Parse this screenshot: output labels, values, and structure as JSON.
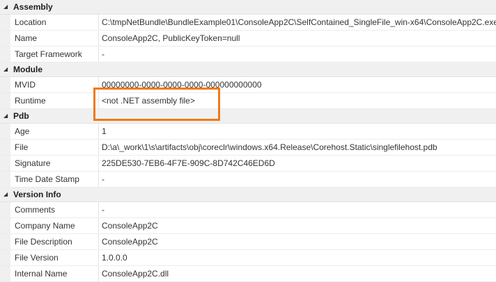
{
  "sections": [
    {
      "title": "Assembly",
      "expanded_glyph": "◢",
      "rows": [
        {
          "key": "Location",
          "value": "C:\\tmpNetBundle\\BundleExample01\\ConsoleApp2C\\SelfContained_SingleFile_win-x64\\ConsoleApp2C.exe"
        },
        {
          "key": "Name",
          "value": "ConsoleApp2C, PublicKeyToken=null"
        },
        {
          "key": "Target Framework",
          "value": "-"
        }
      ]
    },
    {
      "title": "Module",
      "expanded_glyph": "◢",
      "rows": [
        {
          "key": "MVID",
          "value": "00000000-0000-0000-0000-000000000000"
        },
        {
          "key": "Runtime",
          "value": "<not .NET assembly file>"
        }
      ]
    },
    {
      "title": "Pdb",
      "expanded_glyph": "◢",
      "rows": [
        {
          "key": "Age",
          "value": "1"
        },
        {
          "key": "File",
          "value": "D:\\a\\_work\\1\\s\\artifacts\\obj\\coreclr\\windows.x64.Release\\Corehost.Static\\singlefilehost.pdb"
        },
        {
          "key": "Signature",
          "value": "225DE530-7EB6-4F7E-909C-8D742C46ED6D"
        },
        {
          "key": "Time Date Stamp",
          "value": "-"
        }
      ]
    },
    {
      "title": "Version Info",
      "expanded_glyph": "◢",
      "rows": [
        {
          "key": "Comments",
          "value": "-"
        },
        {
          "key": "Company Name",
          "value": "ConsoleApp2C"
        },
        {
          "key": "File Description",
          "value": "ConsoleApp2C"
        },
        {
          "key": "File Version",
          "value": "1.0.0.0"
        },
        {
          "key": "Internal Name",
          "value": "ConsoleApp2C.dll"
        }
      ]
    }
  ],
  "colors": {
    "highlight": "#f07a16",
    "section_background": "#f0f0f0"
  }
}
